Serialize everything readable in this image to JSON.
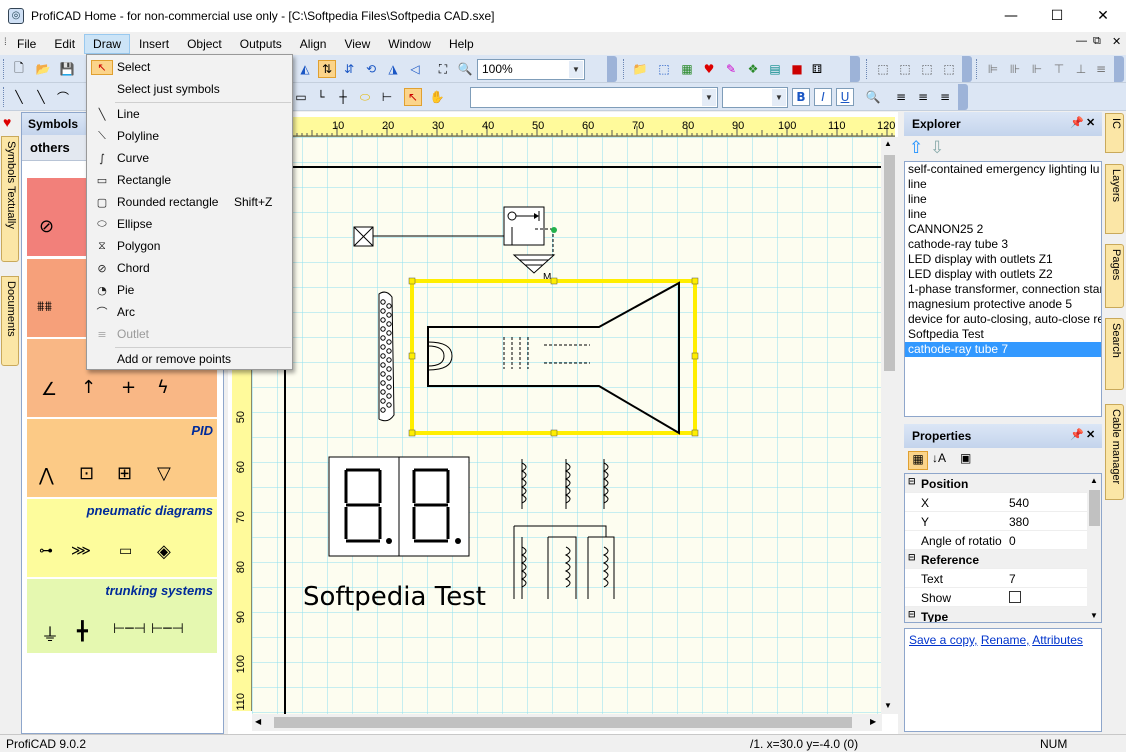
{
  "window": {
    "title": "ProfiCAD Home - for non-commercial use only - [C:\\Softpedia Files\\Softpedia CAD.sxe]",
    "minimize": "—",
    "maximize": "☐",
    "close": "✕"
  },
  "menu": [
    "File",
    "Edit",
    "Draw",
    "Insert",
    "Object",
    "Outputs",
    "Align",
    "View",
    "Window",
    "Help"
  ],
  "toolbar": {
    "zoom": "100%"
  },
  "draw_menu": {
    "select": "Select",
    "select_symbols": "Select just symbols",
    "line": "Line",
    "polyline": "Polyline",
    "curve": "Curve",
    "rectangle": "Rectangle",
    "rounded_rectangle": "Rounded rectangle",
    "rounded_rectangle_shortcut": "Shift+Z",
    "ellipse": "Ellipse",
    "polygon": "Polygon",
    "chord": "Chord",
    "pie": "Pie",
    "arc": "Arc",
    "outlet": "Outlet",
    "add_remove_points": "Add or remove points"
  },
  "symbols_panel": {
    "title": "Symbols",
    "category": "others",
    "left_tabs": [
      "Symbols Textually",
      "Documents"
    ],
    "sections": [
      "PID",
      "pneumatic diagrams",
      "trunking systems"
    ]
  },
  "ruler": {
    "h_ticks": [
      "10",
      "20",
      "30",
      "40",
      "50",
      "60",
      "70",
      "80",
      "90",
      "100",
      "110",
      "120"
    ],
    "v_ticks": [
      "50",
      "60",
      "70",
      "80",
      "90",
      "100",
      "110"
    ]
  },
  "canvas": {
    "text": "Softpedia Test",
    "label_marker": "M"
  },
  "explorer": {
    "title": "Explorer",
    "items": [
      "self-contained emergency lighting lu",
      "line",
      "line",
      "line",
      "CANNON25 2",
      "cathode-ray tube 3",
      "LED display with outlets Z1",
      "LED display with outlets Z2",
      "1-phase transformer, connection star",
      "magnesium protective anode 5",
      "device for auto-closing, auto-close re",
      "Softpedia Test",
      "cathode-ray tube 7"
    ],
    "selected_index": 12
  },
  "right_tabs": [
    "IC",
    "Layers",
    "Pages",
    "Search",
    "Cable manager"
  ],
  "properties": {
    "title": "Properties",
    "position_group": "Position",
    "x_label": "X",
    "x_value": "540",
    "y_label": "Y",
    "y_value": "380",
    "angle_label": "Angle of rotatio",
    "angle_value": "0",
    "reference_group": "Reference",
    "text_label": "Text",
    "text_value": "7",
    "show_label": "Show",
    "type_group": "Type",
    "links": [
      "Save a copy,",
      "Rename,",
      "Attributes"
    ]
  },
  "status": {
    "version": "ProfiCAD 9.0.2",
    "coords": "/1.  x=30.0  y=-4.0 (0)",
    "num": "NUM"
  },
  "colors": {
    "accent": "#3399ff",
    "ruler": "#fffa9b",
    "selection": "#ffee00",
    "grid": "#8fe0f0"
  }
}
